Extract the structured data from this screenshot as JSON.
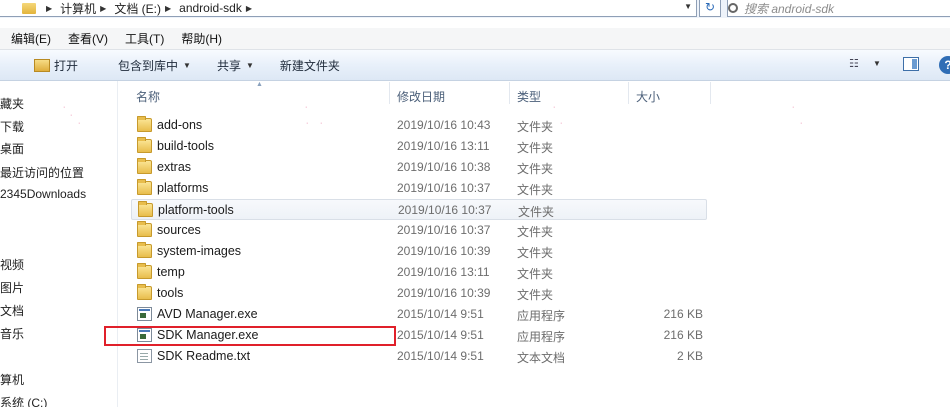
{
  "address_bar": {
    "crumbs": [
      "计算机",
      "文档 (E:)",
      "android-sdk"
    ],
    "search_placeholder": "搜索 android-sdk"
  },
  "menu": [
    "编辑(E)",
    "查看(V)",
    "工具(T)",
    "帮助(H)"
  ],
  "toolbar": {
    "open": "打开",
    "include_in_library": "包含到库中",
    "share": "共享",
    "new_folder": "新建文件夹"
  },
  "nav": [
    "藏夹",
    "下载",
    "桌面",
    "最近访问的位置",
    "2345Downloads",
    "视频",
    "图片",
    "文档",
    "音乐",
    "算机",
    "系统 (C:)"
  ],
  "columns": {
    "name": "名称",
    "date": "修改日期",
    "type": "类型",
    "size": "大小"
  },
  "files": [
    {
      "name": "add-ons",
      "date": "2019/10/16 10:43",
      "type": "文件夹",
      "size": "",
      "icon": "folder-icon"
    },
    {
      "name": "build-tools",
      "date": "2019/10/16 13:11",
      "type": "文件夹",
      "size": "",
      "icon": "folder-icon"
    },
    {
      "name": "extras",
      "date": "2019/10/16 10:38",
      "type": "文件夹",
      "size": "",
      "icon": "folder-icon"
    },
    {
      "name": "platforms",
      "date": "2019/10/16 10:37",
      "type": "文件夹",
      "size": "",
      "icon": "folder-icon"
    },
    {
      "name": "platform-tools",
      "date": "2019/10/16 10:37",
      "type": "文件夹",
      "size": "",
      "icon": "folder-icon"
    },
    {
      "name": "sources",
      "date": "2019/10/16 10:37",
      "type": "文件夹",
      "size": "",
      "icon": "folder-icon"
    },
    {
      "name": "system-images",
      "date": "2019/10/16 10:39",
      "type": "文件夹",
      "size": "",
      "icon": "folder-icon"
    },
    {
      "name": "temp",
      "date": "2019/10/16 13:11",
      "type": "文件夹",
      "size": "",
      "icon": "folder-icon"
    },
    {
      "name": "tools",
      "date": "2019/10/16 10:39",
      "type": "文件夹",
      "size": "",
      "icon": "folder-icon"
    },
    {
      "name": "AVD Manager.exe",
      "date": "2015/10/14 9:51",
      "type": "应用程序",
      "size": "216 KB",
      "icon": "exe-icon"
    },
    {
      "name": "SDK Manager.exe",
      "date": "2015/10/14 9:51",
      "type": "应用程序",
      "size": "216 KB",
      "icon": "exe-icon"
    },
    {
      "name": "SDK Readme.txt",
      "date": "2015/10/14 9:51",
      "type": "文本文档",
      "size": "2 KB",
      "icon": "txt-icon"
    }
  ],
  "colors": {
    "highlight_box": "#e0202a",
    "accent": "#2f6db5"
  }
}
